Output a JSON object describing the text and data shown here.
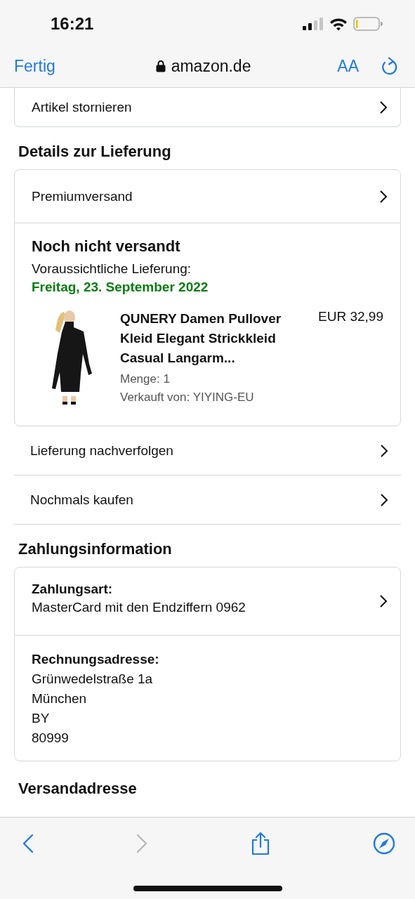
{
  "status_bar": {
    "time": "16:21"
  },
  "browser_bar": {
    "done": "Fertig",
    "address": "amazon.de",
    "text_size": "AA"
  },
  "cancel_row": {
    "label": "Artikel stornieren"
  },
  "delivery": {
    "heading": "Details zur Lieferung",
    "shipping_option": "Premiumversand",
    "status": "Noch nicht versandt",
    "expected_label": "Voraussichtliche Lieferung:",
    "expected_date": "Freitag, 23. September 2022",
    "item": {
      "kind": "picture",
      "title": "QUNERY Damen Pullover Kleid Elegant Strickkleid Casual Langarm...",
      "price": "EUR 32,99",
      "quantity": "Menge: 1",
      "seller": "Verkauft von: YIYING-EU"
    }
  },
  "actions": [
    {
      "label": "Lieferung nachverfolgen"
    },
    {
      "label": "Nochmals kaufen"
    }
  ],
  "payment": {
    "heading": "Zahlungsinformation",
    "method_label": "Zahlungsart:",
    "method": "MasterCard mit den Endziffern 0962",
    "address_label": "Rechnungsadresse:",
    "address_lines": [
      "Grünwedelstraße 1a",
      "München",
      "BY",
      "80999"
    ]
  },
  "next_heading": "Versandadresse",
  "toolbar": [
    {
      "kind": "back",
      "disabled": false
    },
    {
      "kind": "forward",
      "disabled": true
    },
    {
      "kind": "share",
      "disabled": false
    },
    {
      "kind": "compass",
      "disabled": false
    }
  ]
}
